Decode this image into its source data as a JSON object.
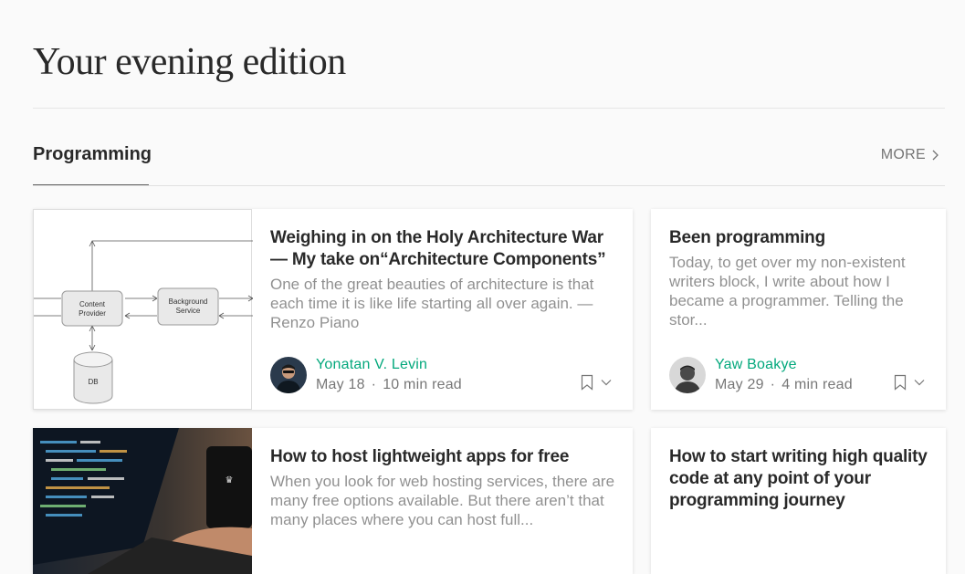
{
  "page": {
    "title": "Your evening edition"
  },
  "section": {
    "title": "Programming",
    "more_label": "MORE"
  },
  "colors": {
    "accent": "#03a87c",
    "text": "rgba(0,0,0,0.84)",
    "muted": "rgba(0,0,0,0.54)"
  },
  "cards": [
    {
      "title": "Weighing in on the Holy Architecture War — My take on“Architecture Components”",
      "excerpt": "One of the great beauties of architecture is that each time it is like life starting all over again. — Renzo Piano",
      "author": "Yonatan V. Levin",
      "date": "May 18",
      "read_time": "10 min read",
      "diagram": {
        "node1_line1": "Content",
        "node1_line2": "Provider",
        "node2_line1": "Background",
        "node2_line2": "Service",
        "db": "DB"
      }
    },
    {
      "title": "Been programming",
      "excerpt": "Today, to get over my non-existent writers block, I write about how I became a programmer. Telling the stor...",
      "author": "Yaw Boakye",
      "date": "May 29",
      "read_time": "4 min read"
    },
    {
      "title": "How to host lightweight apps for free",
      "excerpt": "When you look for web hosting services, there are many free options available. But there aren’t that many places where you can host full..."
    },
    {
      "title": "How to start writing high quality code at any point of your programming journey"
    }
  ],
  "icons": {
    "more": "chevron-right-icon",
    "bookmark": "bookmark-icon",
    "menu": "chevron-down-icon"
  }
}
